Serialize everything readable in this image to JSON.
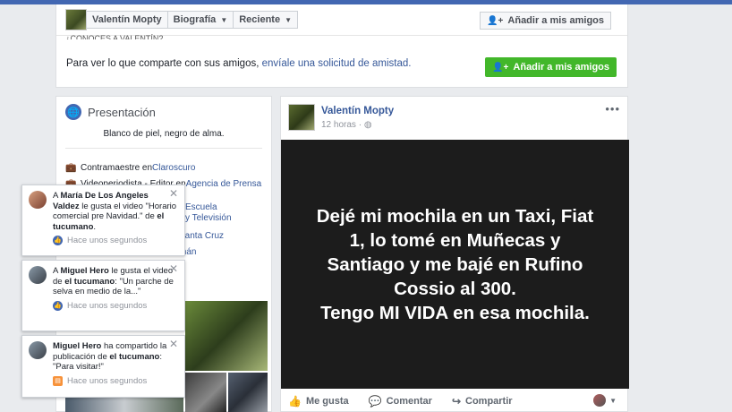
{
  "header": {
    "profile_name": "Valentín Mopty",
    "nav": [
      "Biografía",
      "Reciente"
    ],
    "add_friend_top": "Añadir a mis amigos",
    "cut_text": "¿CONOCES A VALENTÍN?",
    "friend_msg_prefix": "Para ver lo que comparte con sus amigos, ",
    "friend_msg_link": "envíale una solicitud de amistad.",
    "add_friend_green": "Añadir a mis amigos"
  },
  "intro": {
    "title": "Presentación",
    "bio": "Blanco de piel, negro de alma.",
    "rows": [
      {
        "icon": "briefcase-icon",
        "prefix": "Contramaestre en ",
        "link": "Claroscuro"
      },
      {
        "icon": "briefcase-icon",
        "prefix": "Videoperiodista - Editor en ",
        "link": "Agencia de Prensa"
      }
    ],
    "partial": [
      "Escuela",
      "y Televisión",
      "Santa Cruz",
      "mán"
    ]
  },
  "post": {
    "author": "Valentín Mopty",
    "time": "12 horas · ",
    "text": "Dejé mi mochila en un Taxi, Fiat\n1, lo tomé en Muñecas y\nSantiago y me bajé en Rufino\nCossio al 300.\nTengo MI VIDA en esa mochila.",
    "actions": [
      "Me gusta",
      "Comentar",
      "Compartir"
    ]
  },
  "notifications": [
    {
      "pre": "A ",
      "name": "María De Los Angeles Valdez",
      "mid": " le gusta el video \"Horario comercial pre Navidad.\" de ",
      "page": "el tucumano",
      "end": ".",
      "time": "Hace unos segundos",
      "type": "like"
    },
    {
      "pre": "A ",
      "name": "Miguel Hero",
      "mid": " le gusta el video de ",
      "page": "el tucumano",
      "end": ": \"Un parche de selva en medio de la...\"",
      "time": "Hace unos segundos",
      "type": "like"
    },
    {
      "pre": "",
      "name": "Miguel Hero",
      "mid": " ha compartido la publicación de ",
      "page": "el tucumano",
      "end": ": \"Para visitar!\"",
      "time": "Hace unos segundos",
      "type": "share"
    }
  ],
  "colors": {
    "brand": "#4267b2",
    "link": "#365899",
    "green": "#42b72a"
  }
}
